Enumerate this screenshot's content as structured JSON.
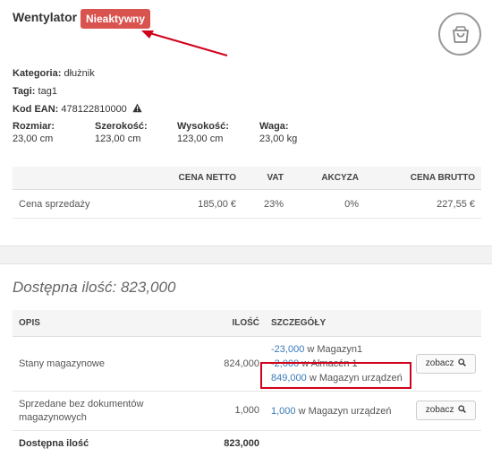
{
  "product": {
    "name": "Wentylator",
    "status_badge": "Nieaktywny",
    "category_label": "Kategoria:",
    "category_value": "dłużnik",
    "tags_label": "Tagi:",
    "tags_value": "tag1",
    "ean_label": "Kod EAN:",
    "ean_value": "478122810000",
    "dimensions": [
      {
        "label": "Rozmiar:",
        "value": "23,00 cm"
      },
      {
        "label": "Szerokość:",
        "value": "123,00 cm"
      },
      {
        "label": "Wysokość:",
        "value": "123,00 cm"
      },
      {
        "label": "Waga:",
        "value": "23,00 kg"
      }
    ]
  },
  "icons": {
    "cart": "shopping-bag-icon",
    "warning": "warning-triangle-icon",
    "search": "magnifier-icon"
  },
  "colors": {
    "badge": "#d9534f",
    "link": "#3a7ab8",
    "highlight_box": "#d0021b",
    "arrow": "#d0021b"
  },
  "price_table": {
    "headers": [
      "CENA NETTO",
      "VAT",
      "AKCYZA",
      "CENA BRUTTO"
    ],
    "row": {
      "label": "Cena sprzedaży",
      "netto": "185,00 €",
      "vat": "23%",
      "akcyza": "0%",
      "brutto": "227,55 €"
    }
  },
  "stock": {
    "title": "Dostępna ilość: 823,000",
    "headers": {
      "opis": "OPIS",
      "ilosc": "ILOŚĆ",
      "szczegoly": "SZCZEGÓŁY"
    },
    "rows": [
      {
        "opis": "Stany magazynowe",
        "ilosc": "824,000",
        "details": [
          {
            "amount": "-23,000",
            "text": " w Magazyn1"
          },
          {
            "amount": "-2,000",
            "text": " w Almacén 1"
          },
          {
            "amount": "849,000",
            "text": " w Magazyn urządzeń"
          }
        ],
        "button": "zobacz"
      },
      {
        "opis_line1": "Sprzedane bez dokumentów",
        "opis_line2": "magazynowych",
        "ilosc": "1,000",
        "details": [
          {
            "amount": "1,000",
            "text": " w Magazyn urządzeń"
          }
        ],
        "button": "zobacz"
      }
    ],
    "total_label": "Dostępna ilość",
    "total_value": "823,000"
  }
}
